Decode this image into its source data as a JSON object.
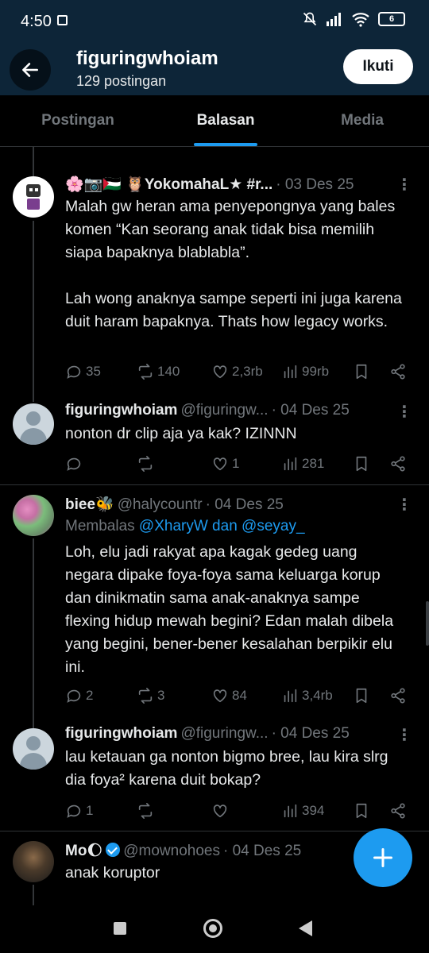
{
  "status": {
    "time": "4:50",
    "battery": "6"
  },
  "header": {
    "title": "figuringwhoiam",
    "subtitle": "129 postingan",
    "follow_label": "Ikuti"
  },
  "tabs": [
    {
      "label": "Postingan",
      "active": false
    },
    {
      "label": "Balasan",
      "active": true
    },
    {
      "label": "Media",
      "active": false
    }
  ],
  "tweets": [
    {
      "name": "🌸📷🇵🇸 🦉YokomahaL★ #r...",
      "handle": "",
      "date": "· 03 Des 25",
      "text": "Malah gw heran ama penyepongnya yang bales komen “Kan seorang anak tidak bisa memilih siapa bapaknya blablabla”.\n\nLah wong anaknya sampe seperti ini juga karena duit haram bapaknya. Thats how legacy works.",
      "replies": "35",
      "reposts": "140",
      "likes": "2,3rb",
      "views": "99rb"
    },
    {
      "name": "figuringwhoiam",
      "handle": "@figuringw...",
      "date": "· 04 Des 25",
      "text": "nonton dr clip aja ya kak? IZINNN",
      "replies": "",
      "reposts": "",
      "likes": "1",
      "views": "281"
    },
    {
      "name": "biee🐝",
      "handle": "@halycountr",
      "date": "· 04 Des 25",
      "reply_prefix": "Membalas ",
      "reply_mentions": "@XharyW dan @seyay_",
      "text": "Loh, elu jadi rakyat apa kagak gedeg uang negara dipake foya-foya sama keluarga korup dan dinikmatin sama anak-anaknya sampe flexing hidup mewah begini? Edan malah dibela yang begini, bener-bener kesalahan berpikir elu ini.",
      "replies": "2",
      "reposts": "3",
      "likes": "84",
      "views": "3,4rb"
    },
    {
      "name": "figuringwhoiam",
      "handle": "@figuringw...",
      "date": "· 04 Des 25",
      "text": "lau ketauan ga nonton bigmo bree, lau kira slrg dia foya² karena duit bokap?",
      "replies": "1",
      "reposts": "",
      "likes": "",
      "views": "394"
    },
    {
      "name": "Mo🌔",
      "handle": "@mownohoes",
      "date": "· 04 Des 25",
      "text": "anak koruptor"
    }
  ],
  "icons": {
    "back": "arrow-left-icon",
    "reply": "reply-icon",
    "repost": "repost-icon",
    "like": "heart-icon",
    "views": "views-icon",
    "bookmark": "bookmark-icon",
    "share": "share-icon",
    "compose": "plus-icon"
  },
  "colors": {
    "accent": "#1d9bf0",
    "header_bg": "#0d2538",
    "background": "#000000",
    "muted": "#71767b"
  }
}
